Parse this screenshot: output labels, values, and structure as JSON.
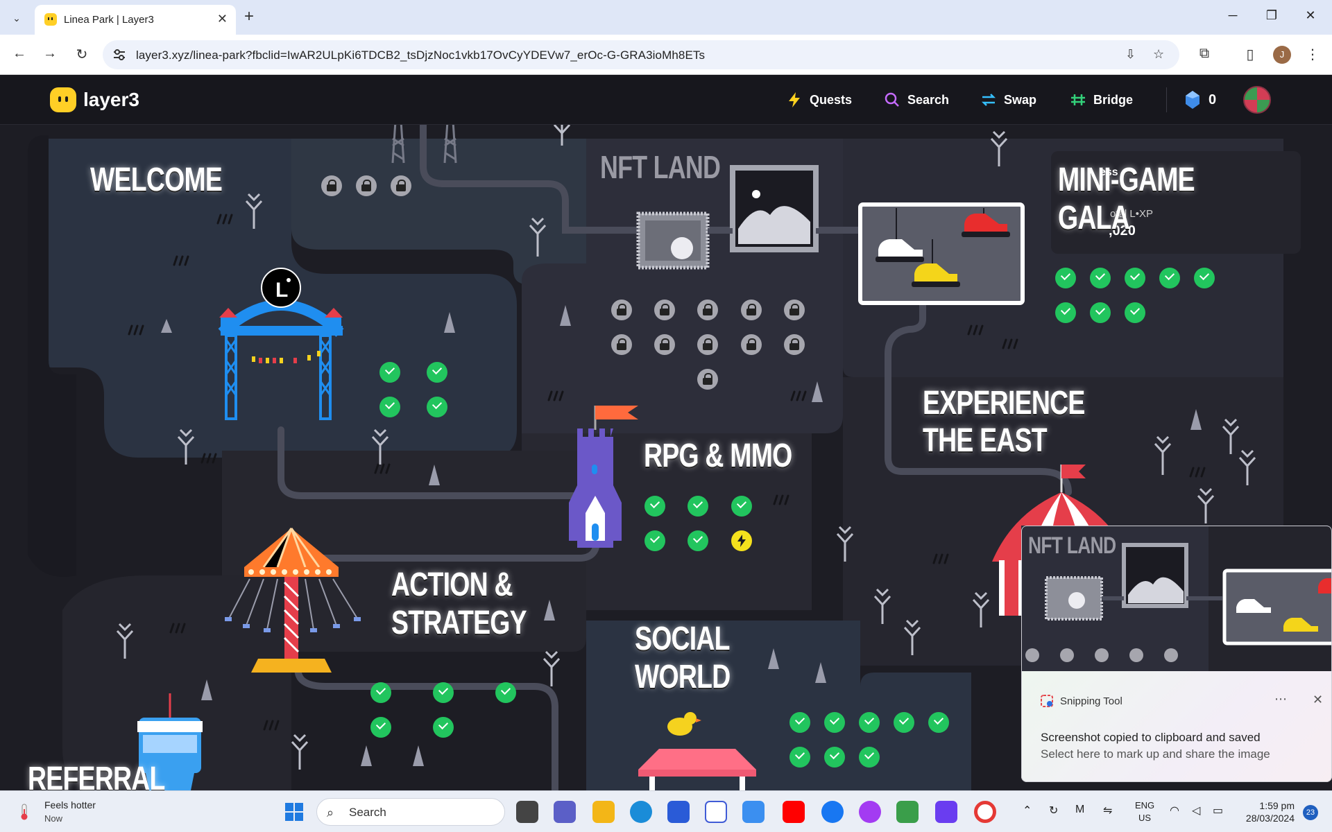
{
  "browser": {
    "tab_title": "Linea Park | Layer3",
    "url": "layer3.xyz/linea-park?fbclid=IwAR2ULpKi6TDCB2_tsDjzNoc1vkb17OvCyYDEVw7_erOc-G-GRA3ioMh8ETs",
    "profile_initial": "J"
  },
  "header": {
    "logo": "layer3",
    "nav": [
      "Quests",
      "Search",
      "Swap",
      "Bridge"
    ],
    "gems": "0"
  },
  "zones": {
    "welcome": "WELCOME",
    "nft_land": "NFT LAND",
    "mini_game_gala_1": "MINI-GAME",
    "mini_game_gala_2": "GALA",
    "rpg": "RPG & MMO",
    "experience_1": "EXPERIENCE",
    "experience_2": "THE EAST",
    "action_1": "ACTION &",
    "action_2": "STRATEGY",
    "social_1": "SOCIAL",
    "social_2": "WORLD",
    "referral": "REFERRAL",
    "nft_land_toast": "NFT LAND"
  },
  "xp_panel": {
    "label": "ess",
    "total": "otal L•XP",
    "value": ",020"
  },
  "toast": {
    "app": "Snipping Tool",
    "heading": "Screenshot copied to clipboard and saved",
    "sub": "Select here to mark up and share the image"
  },
  "taskbar": {
    "weather_1": "Feels hotter",
    "weather_2": "Now",
    "search": "Search",
    "lang_1": "ENG",
    "lang_2": "US",
    "time": "1:59 pm",
    "date": "28/03/2024",
    "badge": "23"
  },
  "colors": {
    "done": "#22c55e",
    "locked": "#a6a6ae",
    "active": "#f5e11d",
    "accent": "#ffcf26"
  }
}
